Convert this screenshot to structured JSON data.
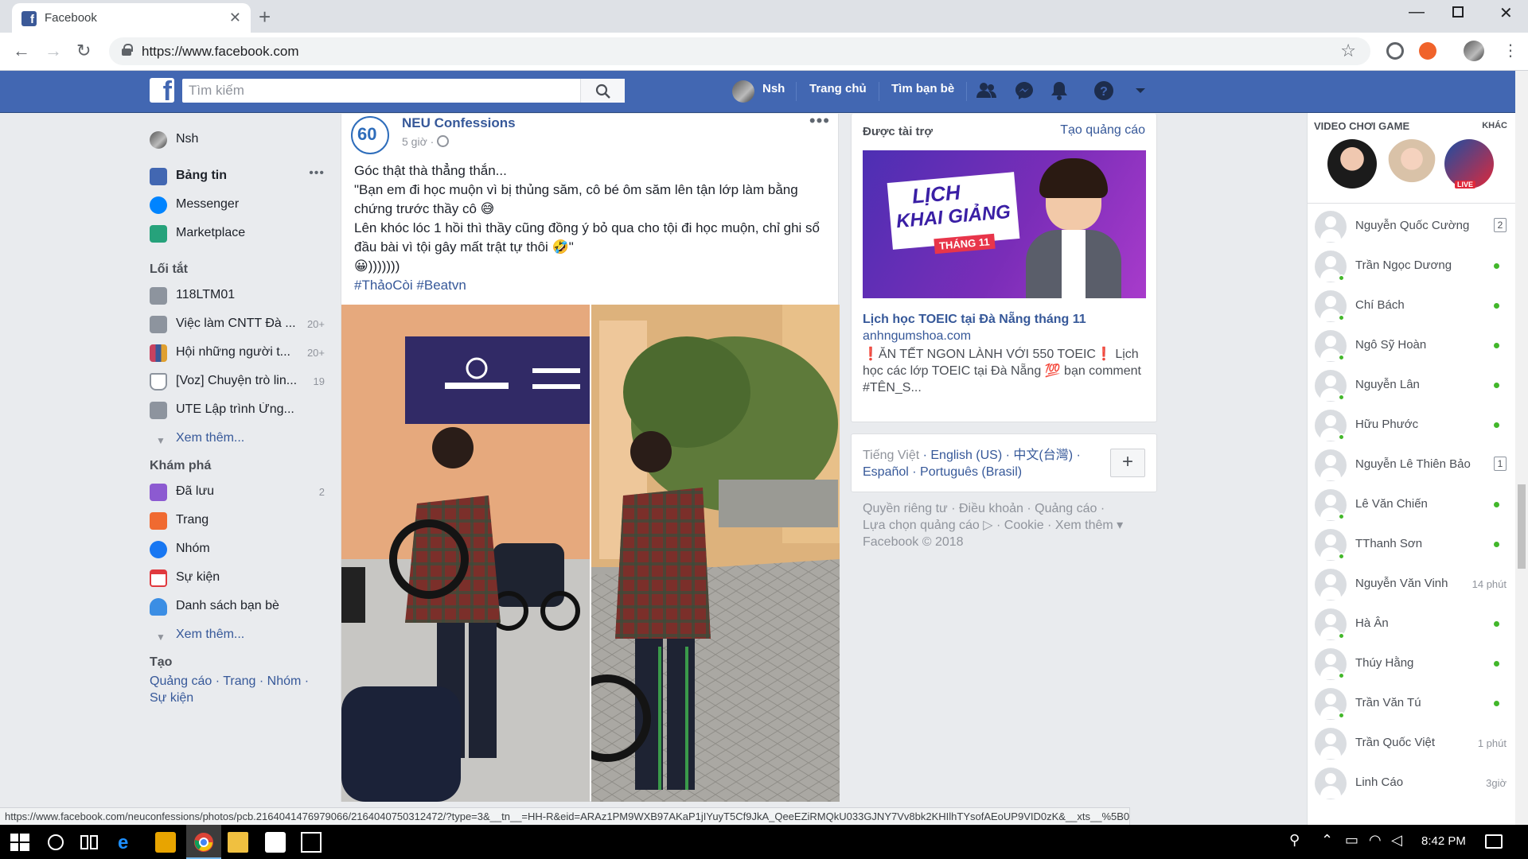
{
  "browser": {
    "tab_title": "Facebook",
    "url": "https://www.facebook.com",
    "status_url": "https://www.facebook.com/neuconfessions/photos/pcb.2164041476979066/2164040750312472/?type=3&__tn__=HH-R&eid=ARAz1PM9WXB97AKaP1jIYuyT5Cf9JkA_QeeEZiRMQkU033GJNY7Vv8bk2KHIlhTYsofAEoUP9VID0zK&__xts__%5B0%5D=68.ARAMIEGPI_Gqi6EiDune88pBa1Zun..."
  },
  "header": {
    "search_placeholder": "Tìm kiếm",
    "user_name": "Nsh",
    "home_label": "Trang chủ",
    "find_friends_label": "Tìm bạn bè",
    "brand_color": "#4267b2"
  },
  "sidebar": {
    "profile_name": "Nsh",
    "main": [
      {
        "label": "Bảng tin",
        "icon": "newsfeed-icon",
        "color": "#4267b2"
      },
      {
        "label": "Messenger",
        "icon": "messenger-icon",
        "color": "#0084ff"
      },
      {
        "label": "Marketplace",
        "icon": "marketplace-icon",
        "color": "#26a27b"
      }
    ],
    "shortcuts_title": "Lối tắt",
    "shortcuts": [
      {
        "label": "118LTM01",
        "count": "",
        "color": "#8d949e"
      },
      {
        "label": "Việc làm CNTT Đà ...",
        "count": "20+",
        "color": "#8d949e"
      },
      {
        "label": "Hội những người t...",
        "count": "20+",
        "color": "#c9425f"
      },
      {
        "label": "[Voz] Chuyện trò lin...",
        "count": "19",
        "color": "#8d949e"
      },
      {
        "label": "UTE Lập trình Ứng...",
        "count": "",
        "color": "#8d949e"
      }
    ],
    "see_more": "Xem thêm...",
    "explore_title": "Khám phá",
    "explore": [
      {
        "label": "Đã lưu",
        "count": "2",
        "color": "#8c5ad1"
      },
      {
        "label": "Trang",
        "count": "",
        "color": "#f06a31"
      },
      {
        "label": "Nhóm",
        "count": "",
        "color": "#1877f2"
      },
      {
        "label": "Sự kiện",
        "count": "",
        "color": "#e0393e"
      },
      {
        "label": "Danh sách bạn bè",
        "count": "",
        "color": "#3b8ee4"
      }
    ],
    "see_more_2": "Xem thêm...",
    "create_title": "Tạo",
    "create_links": "Quảng cáo · Trang · Nhóm · Sự kiện"
  },
  "post": {
    "page_name": "NEU Confessions",
    "time": "5 giờ ·",
    "more": "•••",
    "lines": [
      "Góc thật thà thẳng thắn...",
      "\"Bạn em đi học muộn vì bị thủng săm, cô bé ôm săm lên tận lớp làm bằng chứng trước thầy cô 😅",
      "Lên khóc lóc 1 hồi thì thầy cũng đồng ý bỏ qua cho tội đi học muộn, chỉ ghi sổ đầu bài vì tội gây mất trật tự thôi 🤣\"",
      "😀)))))))"
    ],
    "hashtags": "#ThảoCòi #Beatvn"
  },
  "ad": {
    "heading": "Được tài trợ",
    "create_ad": "Tạo quảng cáo",
    "image_text_1": "LỊCH",
    "image_text_2": "KHAI GIẢNG",
    "image_text_3": "THÁNG 11",
    "title": "Lịch học TOEIC tại Đà Nẵng tháng 11",
    "domain": "anhngumshoa.com",
    "text": "❗ĂN TẾT NGON LÀNH VỚI 550 TOEIC❗ Lịch học các lớp TOEIC tại Đà Nẵng 💯 bạn comment #TÊN_S..."
  },
  "languages": {
    "current": "Tiếng Việt",
    "others": [
      "English (US)",
      "中文(台灣)",
      "Español",
      "Português (Brasil)"
    ]
  },
  "footer": {
    "links_line_1": "Quyền riêng tư · Điều khoản · Quảng cáo ·",
    "links_line_2": "Lựa chọn quảng cáo ▷ · Cookie · Xem thêm ▾",
    "copyright": "Facebook © 2018"
  },
  "chat": {
    "game_title": "VIDEO CHƠI GAME",
    "game_more": "KHÁC",
    "contacts": [
      {
        "name": "Nguyễn Quốc Cường",
        "status": "badge",
        "value": "2"
      },
      {
        "name": "Trần Ngọc Dương",
        "status": "online",
        "value": ""
      },
      {
        "name": "Chí Bách",
        "status": "online",
        "value": ""
      },
      {
        "name": "Ngô Sỹ Hoàn",
        "status": "online",
        "value": ""
      },
      {
        "name": "Nguyễn Lân",
        "status": "online",
        "value": ""
      },
      {
        "name": "Hữu Phước",
        "status": "online",
        "value": ""
      },
      {
        "name": "Nguyễn Lê Thiên Bảo",
        "status": "badge",
        "value": "1"
      },
      {
        "name": "Lê Văn Chiến",
        "status": "online",
        "value": ""
      },
      {
        "name": "TThanh Sơn",
        "status": "online",
        "value": ""
      },
      {
        "name": "Nguyễn Văn Vinh",
        "status": "ago",
        "value": "14 phút"
      },
      {
        "name": "Hà Ân",
        "status": "online",
        "value": ""
      },
      {
        "name": "Thúy Hằng",
        "status": "online",
        "value": ""
      },
      {
        "name": "Trần Văn Tú",
        "status": "online",
        "value": ""
      },
      {
        "name": "Trần Quốc Việt",
        "status": "ago",
        "value": "1 phút"
      },
      {
        "name": "Linh Cáo",
        "status": "ago",
        "value": "3giờ"
      }
    ]
  },
  "taskbar": {
    "time": "8:42 PM"
  }
}
